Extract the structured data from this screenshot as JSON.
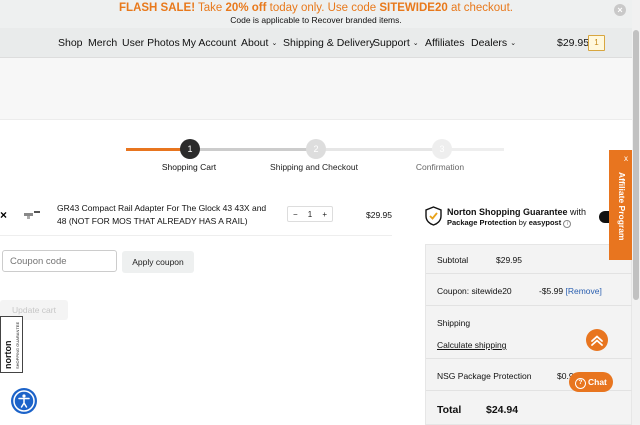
{
  "banner": {
    "sale_label": "FLASH SALE!",
    "take_text": " Take ",
    "discount": "20% off",
    "after_discount": " today only. Use code ",
    "code": "SITEWIDE20",
    "after_code": " at checkout.",
    "subline": "Code is applicable to Recover branded items."
  },
  "nav": {
    "items": [
      "Shop",
      "Merch",
      "User Photos",
      "My Account",
      "About",
      "Shipping & Delivery",
      "Support",
      "Affiliates",
      "Dealers"
    ],
    "cart_total": "$29.95",
    "cart_count": "1"
  },
  "progress": {
    "steps": [
      {
        "number": "1",
        "label": "Shopping Cart"
      },
      {
        "number": "2",
        "label": "Shipping and Checkout"
      },
      {
        "number": "3",
        "label": "Confirmation"
      }
    ]
  },
  "cart": {
    "remove_symbol": "×",
    "product_name": "GR43 Compact Rail Adapter For The Glock 43 43X and 48 (NOT FOR MOS THAT ALREADY HAS A RAIL)",
    "qty_minus": "−",
    "quantity": "1",
    "qty_plus": "+",
    "line_price": "$29.95",
    "coupon_placeholder": "Coupon code",
    "apply_label": "Apply coupon",
    "update_label": "Update cart"
  },
  "nsg": {
    "title": "Norton Shopping Guarantee",
    "with": " with",
    "line2_bold": "Package Protection",
    "line2_by": " by ",
    "provider": "easypost",
    "info": "i"
  },
  "totals": {
    "subtotal_label": "Subtotal",
    "subtotal_value": "$29.95",
    "coupon_label": "Coupon: sitewide20",
    "coupon_value": "-$5.99",
    "remove_link": "[Remove]",
    "shipping_label": "Shipping",
    "calc_link": "Calculate shipping",
    "nsg_label": "NSG Package Protection",
    "nsg_value": "$0.9",
    "total_label": "Total",
    "total_value": "$24.94"
  },
  "affiliate": {
    "label": "Affiliate Program",
    "close": "x"
  },
  "chat": {
    "label": "Chat",
    "q": "?"
  },
  "norton_badge": {
    "brand": "norton",
    "sub": "SHOPPING GUARANTEE"
  },
  "colors": {
    "accent": "#e8751f",
    "link": "#2a5fb0",
    "access": "#1c63c9"
  }
}
